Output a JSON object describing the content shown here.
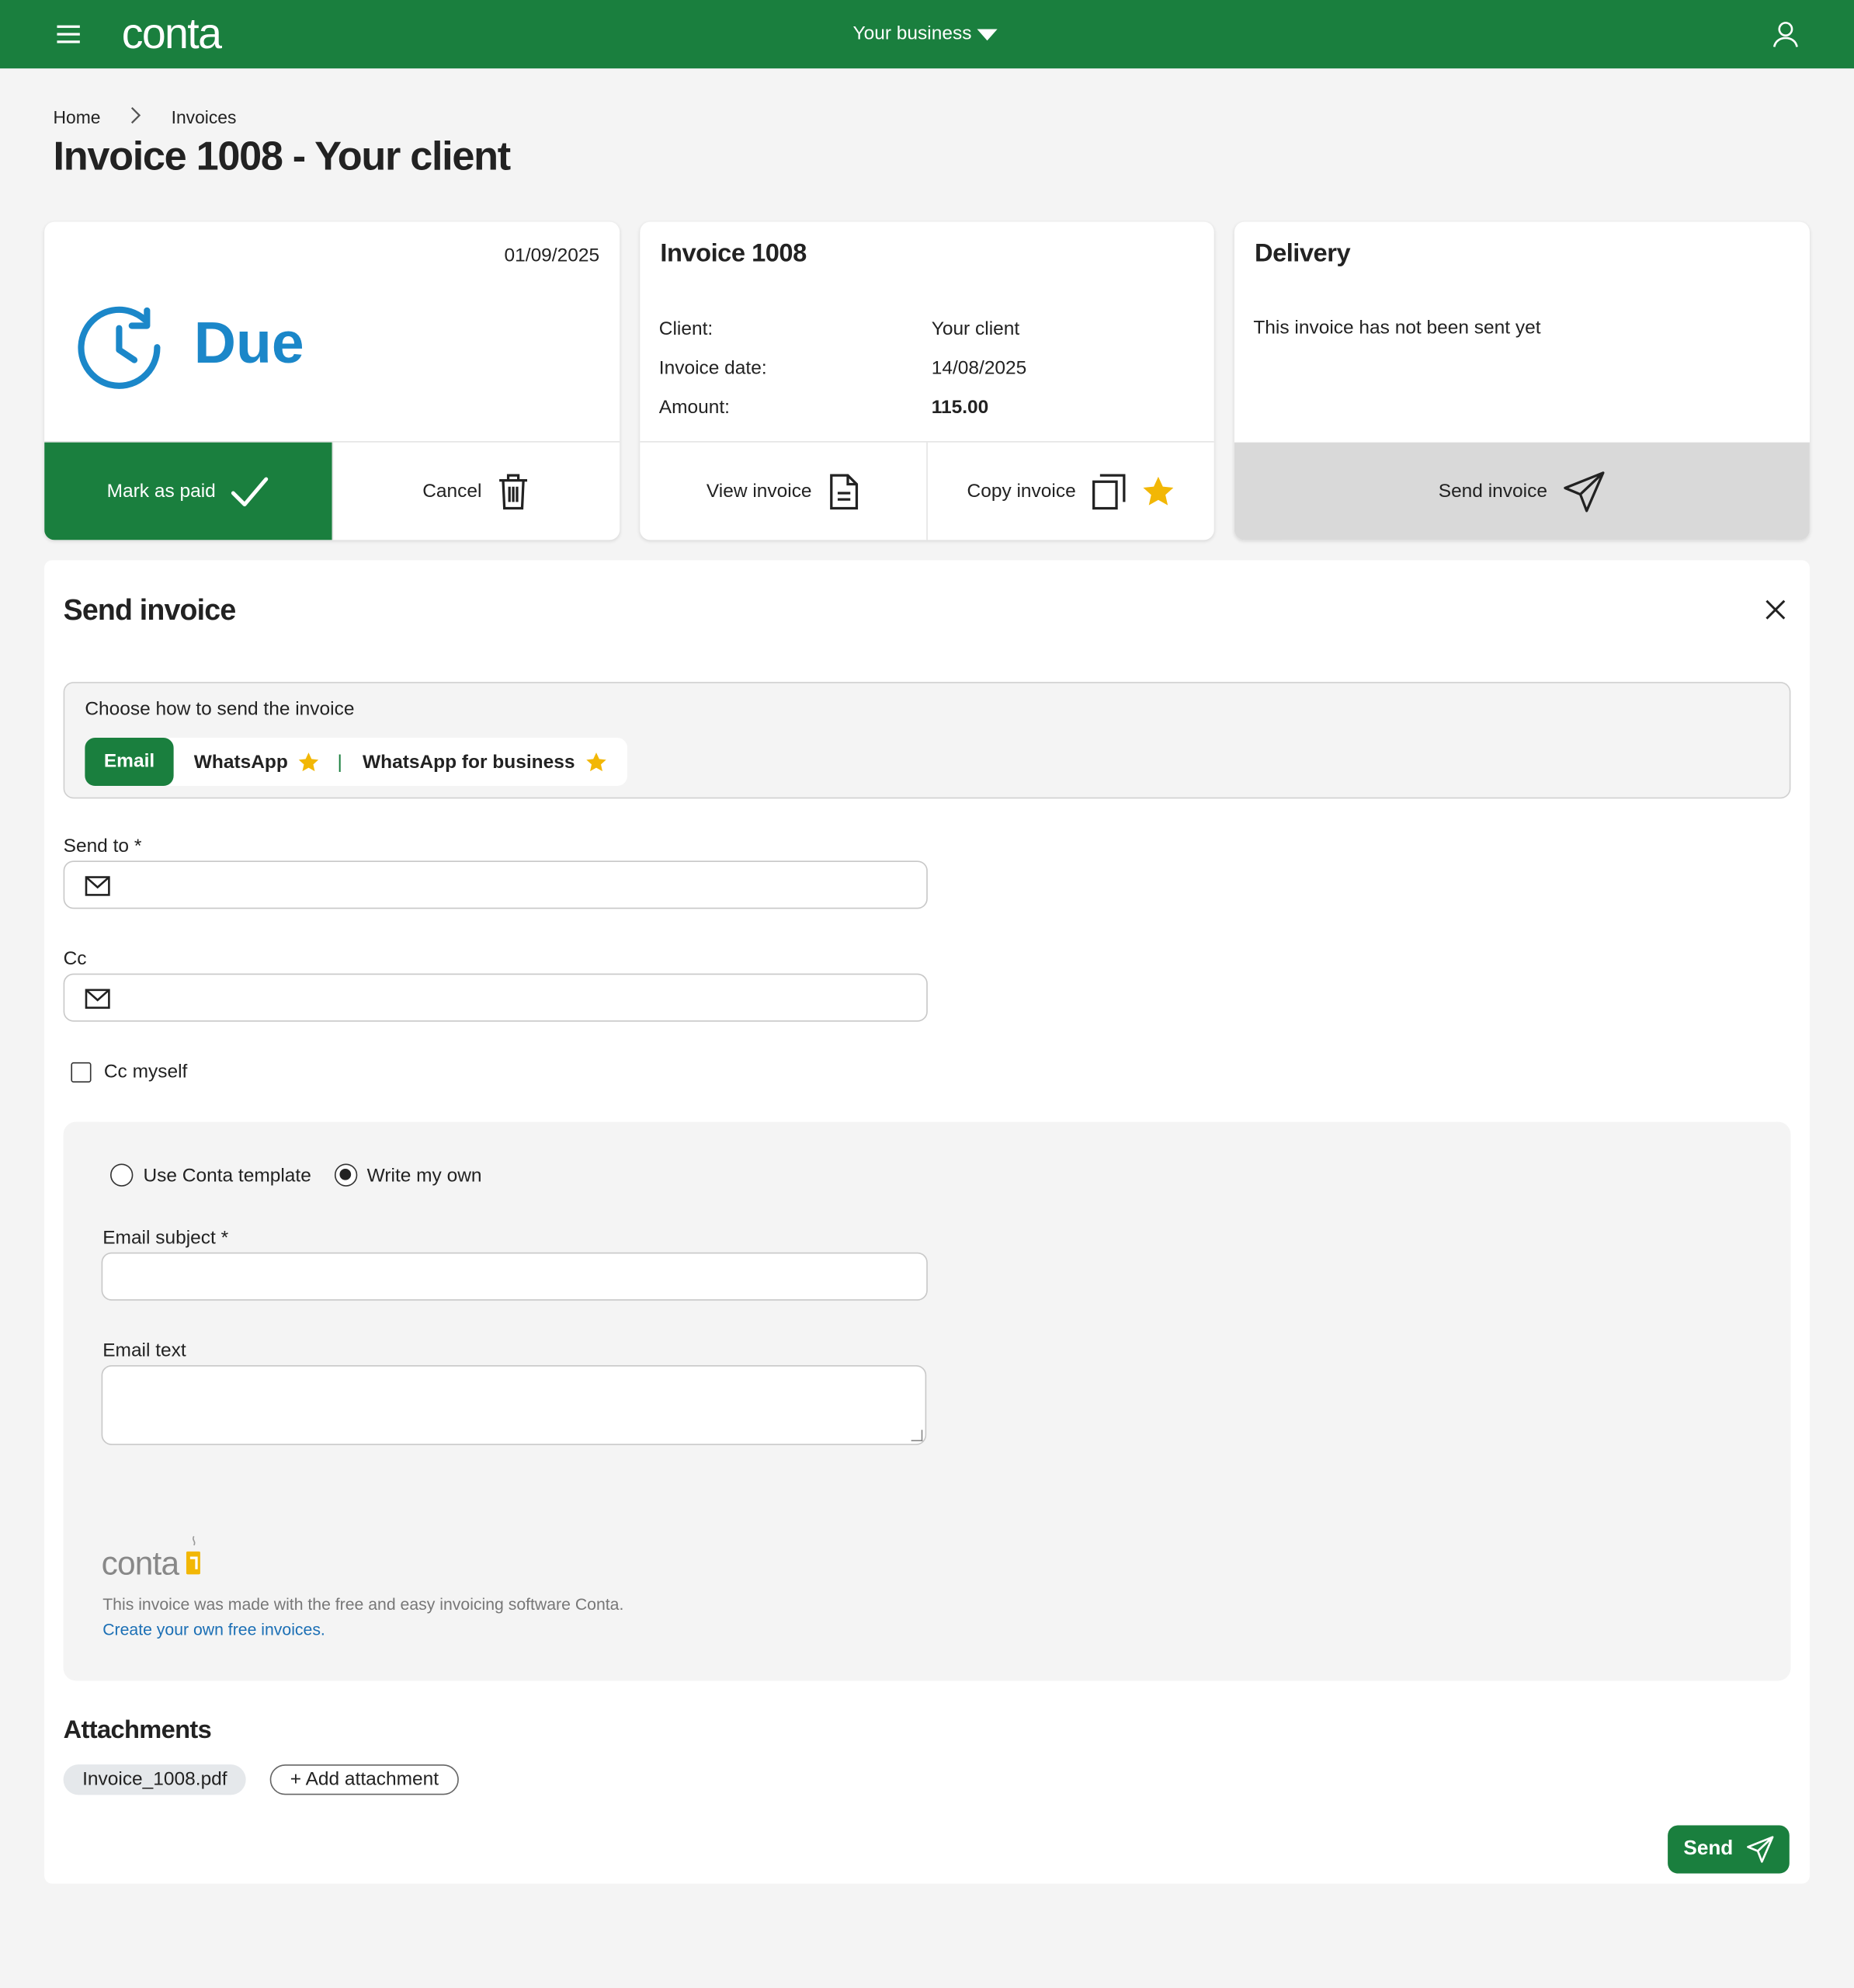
{
  "topbar": {
    "brand": "conta",
    "business_label": "Your business"
  },
  "breadcrumb": {
    "home": "Home",
    "invoices": "Invoices"
  },
  "page_title": "Invoice 1008 - Your client",
  "status_card": {
    "date": "01/09/2025",
    "status": "Due",
    "mark_paid_label": "Mark as paid",
    "cancel_label": "Cancel"
  },
  "invoice_card": {
    "title": "Invoice 1008",
    "client_label": "Client:",
    "client_value": "Your client",
    "date_label": "Invoice date:",
    "date_value": "14/08/2025",
    "amount_label": "Amount:",
    "amount_value": "115.00",
    "view_label": "View invoice",
    "copy_label": "Copy invoice"
  },
  "delivery_card": {
    "title": "Delivery",
    "text": "This invoice has not been sent yet",
    "send_label": "Send invoice"
  },
  "send_panel": {
    "title": "Send invoice",
    "method_prompt": "Choose how to send the invoice",
    "methods": [
      "Email",
      "WhatsApp",
      "WhatsApp for business"
    ],
    "send_to_label": "Send to *",
    "cc_label": "Cc",
    "cc_myself_label": "Cc myself",
    "template_options": [
      "Use Conta template",
      "Write my own"
    ],
    "subject_label": "Email subject *",
    "text_label": "Email text",
    "footer_brand": "conta",
    "footer_made": "This invoice was made with the free and easy invoicing software Conta.",
    "footer_link": "Create your own free invoices.",
    "attachments_title": "Attachments",
    "attachment_file": "Invoice_1008.pdf",
    "add_attachment": "Add attachment",
    "send_button": "Send"
  },
  "colors": {
    "brand_green": "#1a7f3e",
    "due_blue": "#1b87c9",
    "star": "#f2b705",
    "link": "#1b6fb5"
  }
}
